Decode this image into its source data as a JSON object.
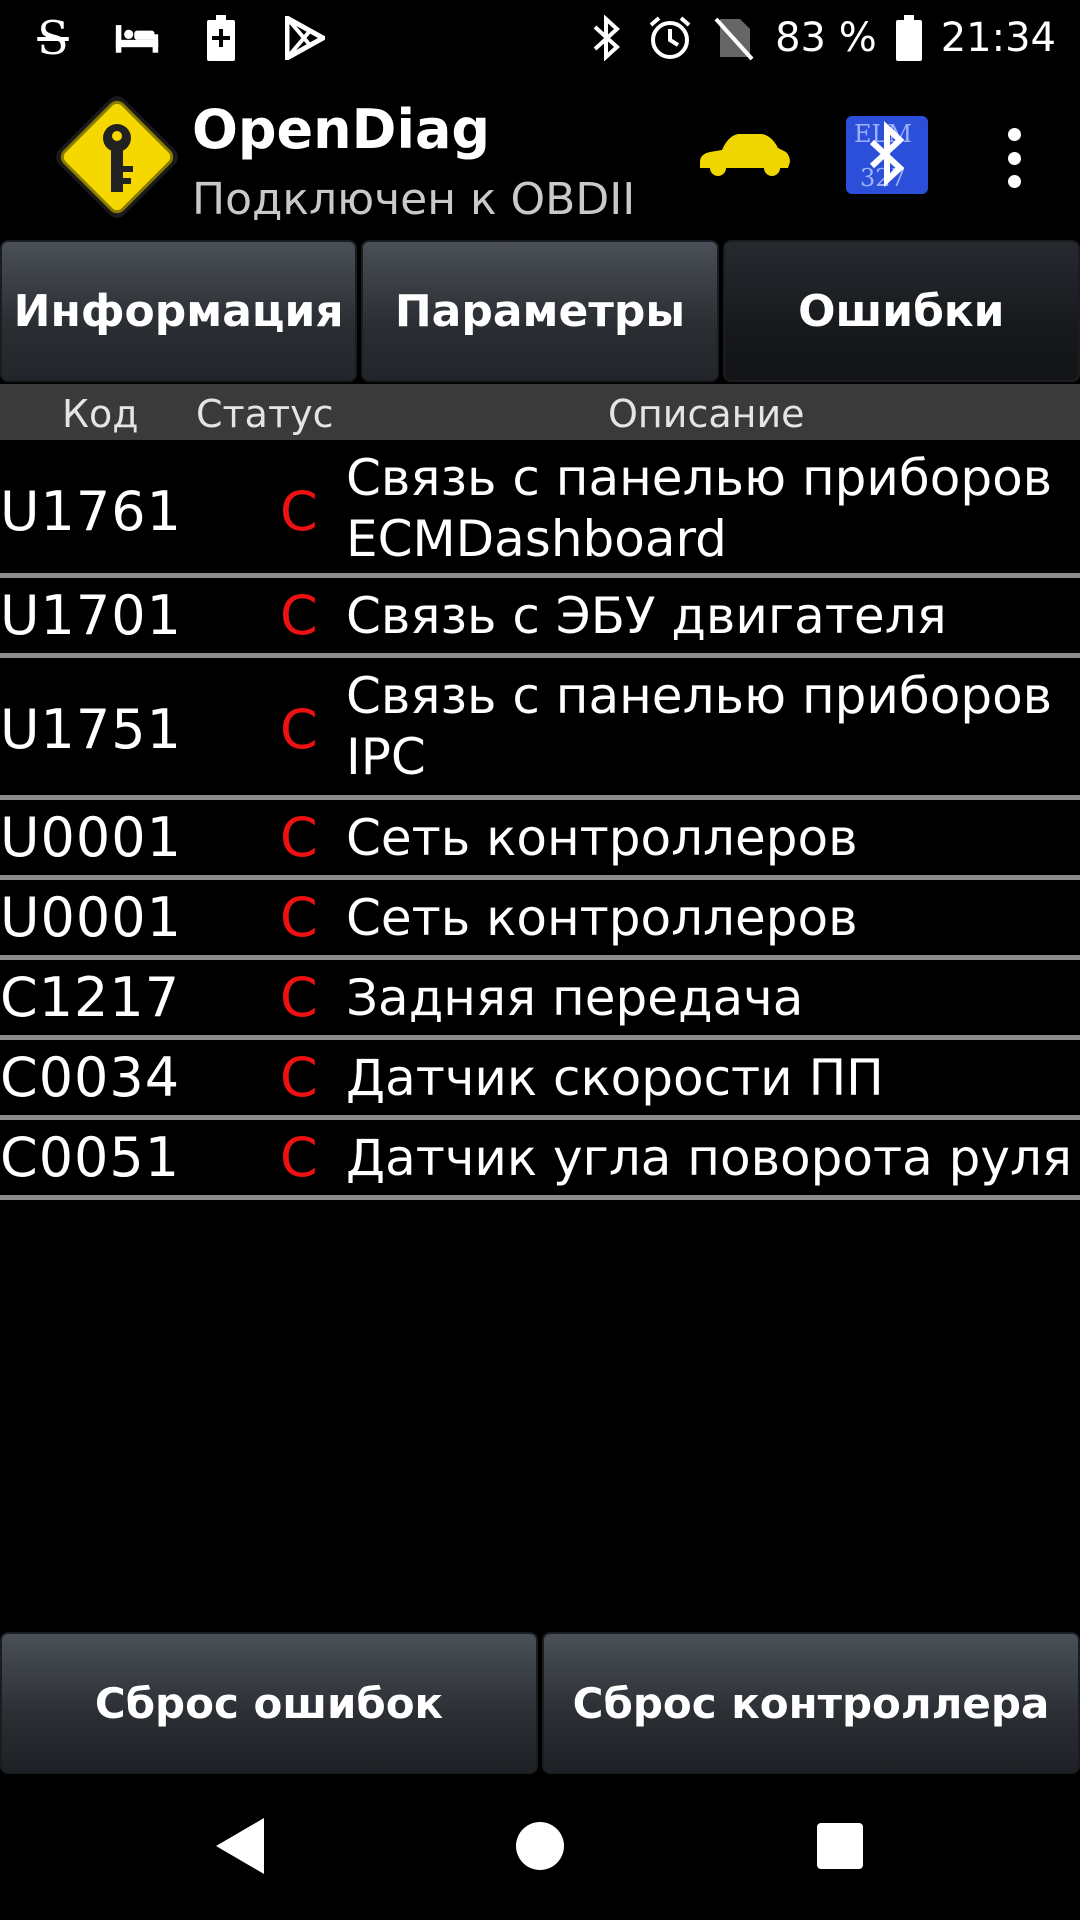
{
  "status_bar": {
    "left_icons": [
      "s-notification-icon",
      "bed-icon",
      "battery-charging-icon",
      "play-store-icon"
    ],
    "right_icons": [
      "bluetooth-icon",
      "alarm-icon",
      "no-sim-icon",
      "battery-icon"
    ],
    "battery_percent": "83 %",
    "time": "21:34"
  },
  "action_bar": {
    "title": "OpenDiag",
    "subtitle": "Подключен к OBDII",
    "logo_icon": "key-diamond-logo-icon",
    "car_icon": "car-icon",
    "adapter_icon": "elm327-bluetooth-icon",
    "overflow_icon": "more-vert-icon",
    "colors": {
      "logo_yellow": "#f5d800",
      "car_yellow": "#f0d600",
      "adapter_blue": "#2b4fd9"
    }
  },
  "tabs": [
    {
      "label": "Информация",
      "active": false
    },
    {
      "label": "Параметры",
      "active": false
    },
    {
      "label": "Ошибки",
      "active": true
    }
  ],
  "table": {
    "headers": {
      "code": "Код",
      "status": "Статус",
      "description": "Описание"
    },
    "rows": [
      {
        "code": "U1761",
        "status": "C",
        "description": [
          "Связь с панелью приборов",
          "ECMDashboard"
        ]
      },
      {
        "code": "U1701",
        "status": "C",
        "description": [
          "Связь с ЭБУ двигателя"
        ]
      },
      {
        "code": "U1751",
        "status": "C",
        "description": [
          "Связь с панелью приборов",
          "IPC"
        ]
      },
      {
        "code": "U0001",
        "status": "C",
        "description": [
          "Сеть контроллеров"
        ]
      },
      {
        "code": "U0001",
        "status": "C",
        "description": [
          "Сеть контроллеров"
        ]
      },
      {
        "code": "C1217",
        "status": "C",
        "description": [
          "Задняя передача"
        ]
      },
      {
        "code": "C0034",
        "status": "C",
        "description": [
          "Датчик скорости ПП"
        ]
      },
      {
        "code": "C0051",
        "status": "C",
        "description": [
          "Датчик угла поворота руля"
        ]
      }
    ],
    "status_color": "#e11111"
  },
  "bottom_buttons": {
    "reset_errors": "Сброс ошибок",
    "reset_controller": "Сброс контроллера"
  },
  "nav_bar": {
    "back_icon": "back-icon",
    "home_icon": "home-icon",
    "recents_icon": "recents-icon"
  }
}
